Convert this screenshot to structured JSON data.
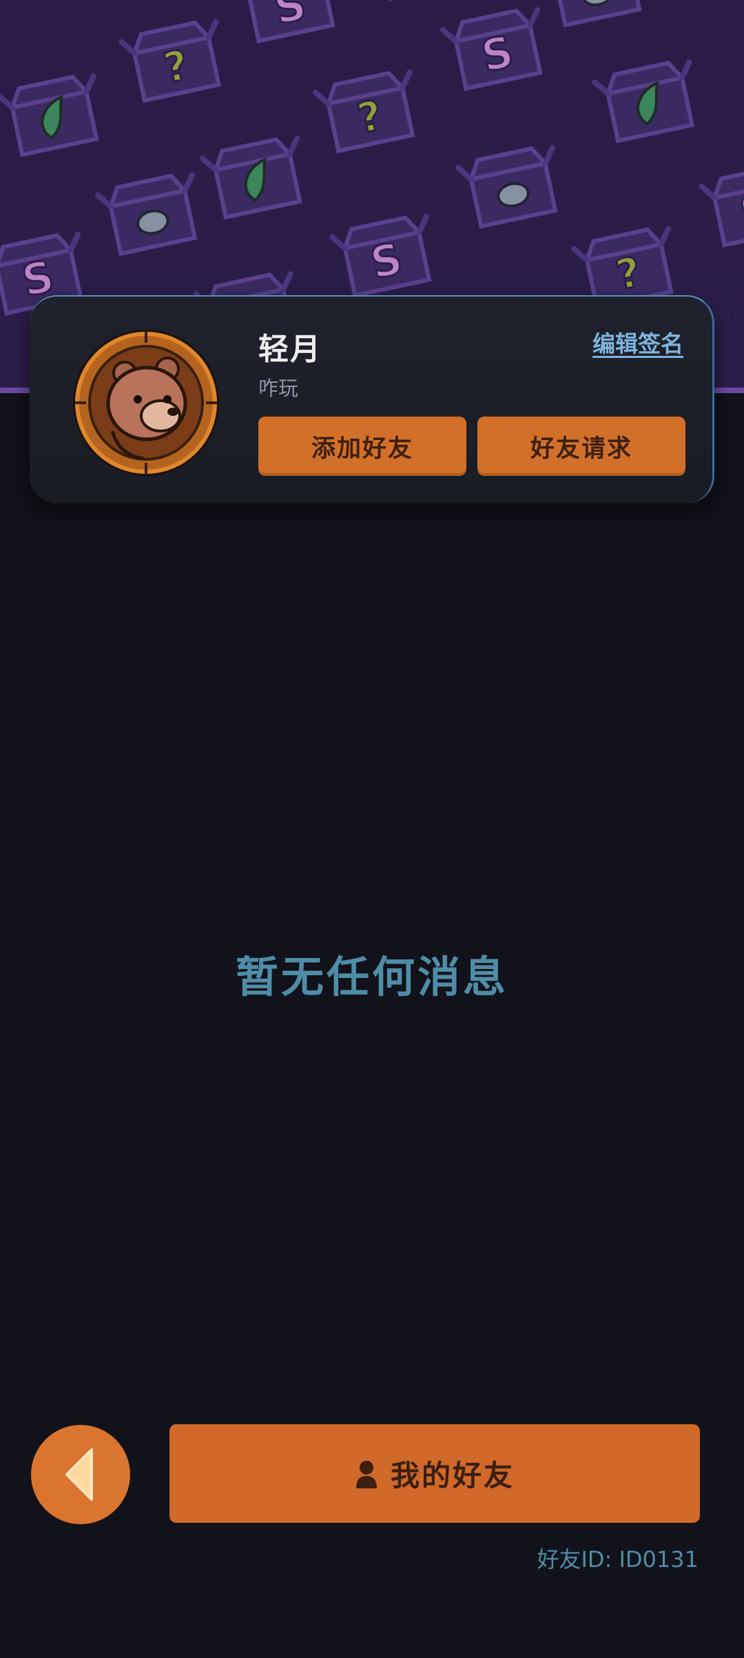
{
  "profile": {
    "name": "轻月",
    "signature": "咋玩",
    "edit_signature_label": "编辑签名",
    "add_friend_label": "添加好友",
    "friend_request_label": "好友请求"
  },
  "messages": {
    "empty_text": "暂无任何消息"
  },
  "bottom": {
    "my_friends_label": "我的好友",
    "friend_id_text": "好友ID: ID0131"
  },
  "icons": {
    "back": "back-arrow-icon",
    "friends": "person-icon",
    "pattern": [
      "treasure-chest-icon",
      "question-mark-icon",
      "s-rune-icon",
      "leaf-icon",
      "gem-icon"
    ]
  },
  "colors": {
    "accent_orange": "#d2702a",
    "background": "#11121a",
    "header_purple": "#2a1c46",
    "muted_blue_text": "#4f8ca8",
    "link_blue": "#7fb4de"
  }
}
